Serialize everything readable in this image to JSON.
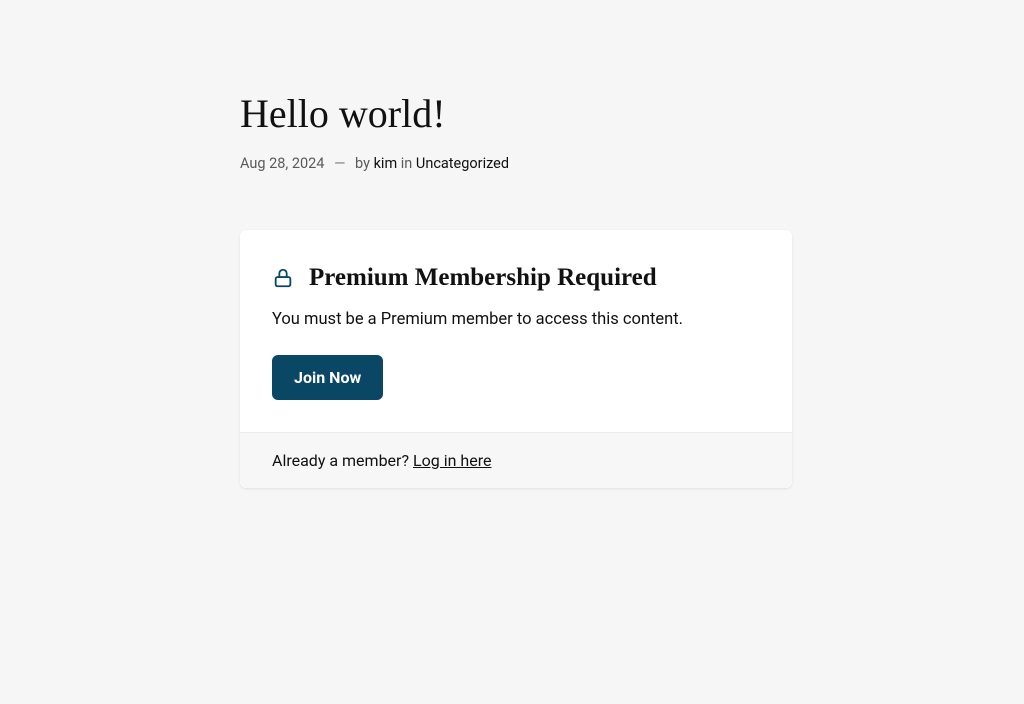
{
  "post": {
    "title": "Hello world!",
    "date": "Aug 28, 2024",
    "separator": "—",
    "by_label": "by",
    "author": "kim",
    "in_label": "in",
    "category": "Uncategorized"
  },
  "membership": {
    "title": "Premium Membership Required",
    "description": "You must be a Premium member to access this content.",
    "join_button": "Join Now",
    "already_member": "Already a member? ",
    "login_link": "Log in here"
  },
  "colors": {
    "accent": "#0a4765"
  }
}
